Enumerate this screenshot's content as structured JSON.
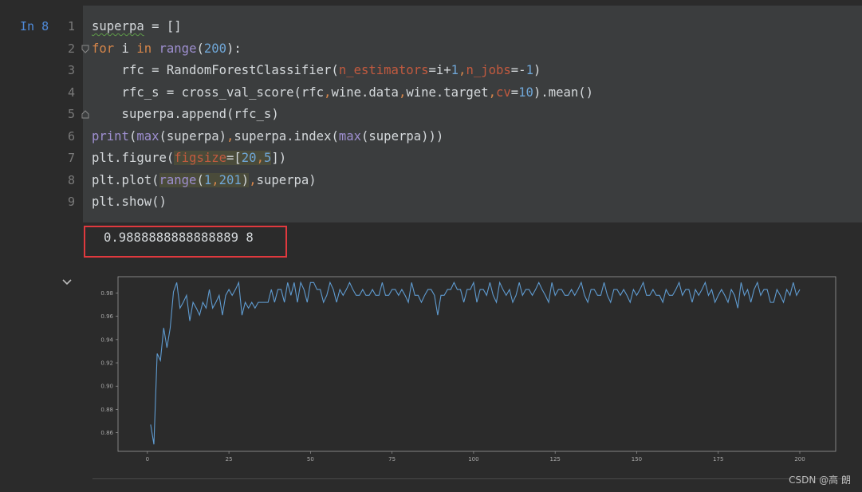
{
  "cell": {
    "prompt": "In 8",
    "line_numbers": [
      "1",
      "2",
      "3",
      "4",
      "5",
      "6",
      "7",
      "8",
      "9"
    ],
    "code": {
      "l1": {
        "a": "superpa",
        "b": " = []"
      },
      "l2": {
        "kw_for": "for",
        "s1": " i ",
        "kw_in": "in",
        "s2": " ",
        "fn": "range",
        "s3": "(",
        "n": "200",
        "s4": "):"
      },
      "l3": {
        "s1": "    rfc = RandomForestClassifier(",
        "p1": "n_estimators",
        "s2": "=i+",
        "n1": "1",
        "s3": ",",
        "p2": "n_jobs",
        "s4": "=-",
        "n2": "1",
        "s5": ")"
      },
      "l4": {
        "s1": "    rfc_s = cross_val_score(rfc",
        "c1": ",",
        "s2": "wine.data",
        "c2": ",",
        "s3": "wine.target",
        "c3": ",",
        "p": "cv",
        "s4": "=",
        "n": "10",
        "s5": ").mean()"
      },
      "l5": {
        "s1": "    superpa.append(rfc_s)"
      },
      "l6": {
        "f1": "print",
        "s1": "(",
        "f2": "max",
        "s2": "(superpa)",
        "c": ",",
        "s3": "superpa.index(",
        "f3": "max",
        "s4": "(superpa)))"
      },
      "l7": {
        "s1": "plt.figure(",
        "p": "figsize",
        "s2": "=[",
        "n1": "20",
        "c": ",",
        "n2": "5",
        "s3": "])"
      },
      "l8": {
        "s1": "plt.plot(",
        "f": "range",
        "s2": "(",
        "n1": "1",
        "c1": ",",
        "n2": "201",
        "s3": ")",
        "c2": ",",
        "s4": "superpa)"
      },
      "l9": {
        "s1": "plt.show()"
      }
    }
  },
  "output": {
    "text": "0.9888888888888889 8"
  },
  "watermark": "CSDN @高 朗",
  "colors": {
    "keyword": "#d6864a",
    "builtin": "#9e8fd0",
    "number": "#6fa6d6",
    "param": "#c25a3f",
    "line": "#5f9bd0",
    "highlight_box": "#e0393e"
  },
  "chart_data": {
    "type": "line",
    "title": "",
    "xlabel": "",
    "ylabel": "",
    "xlim": [
      -9,
      211
    ],
    "ylim": [
      0.844,
      0.994
    ],
    "xticks": [
      0,
      25,
      50,
      75,
      100,
      125,
      150,
      175,
      200
    ],
    "yticks": [
      0.86,
      0.88,
      0.9,
      0.92,
      0.94,
      0.96,
      0.98
    ],
    "ytick_labels": [
      "0.86",
      "0.88",
      "0.90",
      "0.92",
      "0.94",
      "0.96",
      "0.98"
    ],
    "series": [
      {
        "x_start": 1,
        "values": [
          0.867,
          0.85,
          0.928,
          0.922,
          0.95,
          0.933,
          0.95,
          0.981,
          0.989,
          0.967,
          0.972,
          0.978,
          0.956,
          0.972,
          0.967,
          0.961,
          0.972,
          0.967,
          0.983,
          0.967,
          0.972,
          0.978,
          0.961,
          0.978,
          0.983,
          0.978,
          0.983,
          0.989,
          0.961,
          0.972,
          0.967,
          0.972,
          0.967,
          0.972,
          0.972,
          0.972,
          0.972,
          0.983,
          0.972,
          0.983,
          0.983,
          0.972,
          0.989,
          0.978,
          0.989,
          0.972,
          0.989,
          0.983,
          0.972,
          0.989,
          0.989,
          0.983,
          0.983,
          0.972,
          0.978,
          0.989,
          0.983,
          0.972,
          0.983,
          0.978,
          0.983,
          0.989,
          0.983,
          0.978,
          0.978,
          0.983,
          0.978,
          0.978,
          0.983,
          0.978,
          0.978,
          0.989,
          0.978,
          0.978,
          0.983,
          0.983,
          0.978,
          0.983,
          0.978,
          0.972,
          0.989,
          0.978,
          0.978,
          0.972,
          0.978,
          0.983,
          0.983,
          0.978,
          0.961,
          0.978,
          0.978,
          0.983,
          0.983,
          0.989,
          0.983,
          0.983,
          0.972,
          0.983,
          0.983,
          0.989,
          0.972,
          0.983,
          0.983,
          0.978,
          0.989,
          0.978,
          0.972,
          0.989,
          0.983,
          0.978,
          0.983,
          0.972,
          0.978,
          0.989,
          0.978,
          0.983,
          0.983,
          0.978,
          0.983,
          0.989,
          0.983,
          0.978,
          0.972,
          0.989,
          0.978,
          0.983,
          0.983,
          0.978,
          0.978,
          0.983,
          0.978,
          0.983,
          0.989,
          0.978,
          0.972,
          0.983,
          0.983,
          0.978,
          0.978,
          0.989,
          0.978,
          0.972,
          0.983,
          0.983,
          0.978,
          0.983,
          0.978,
          0.972,
          0.983,
          0.978,
          0.983,
          0.989,
          0.978,
          0.978,
          0.983,
          0.978,
          0.978,
          0.972,
          0.983,
          0.978,
          0.978,
          0.983,
          0.989,
          0.978,
          0.983,
          0.983,
          0.972,
          0.983,
          0.978,
          0.983,
          0.989,
          0.978,
          0.983,
          0.972,
          0.978,
          0.983,
          0.978,
          0.972,
          0.983,
          0.978,
          0.967,
          0.989,
          0.978,
          0.983,
          0.972,
          0.983,
          0.989,
          0.978,
          0.983,
          0.983,
          0.972,
          0.972,
          0.983,
          0.978,
          0.972,
          0.983,
          0.978,
          0.989,
          0.978,
          0.983
        ]
      }
    ]
  }
}
